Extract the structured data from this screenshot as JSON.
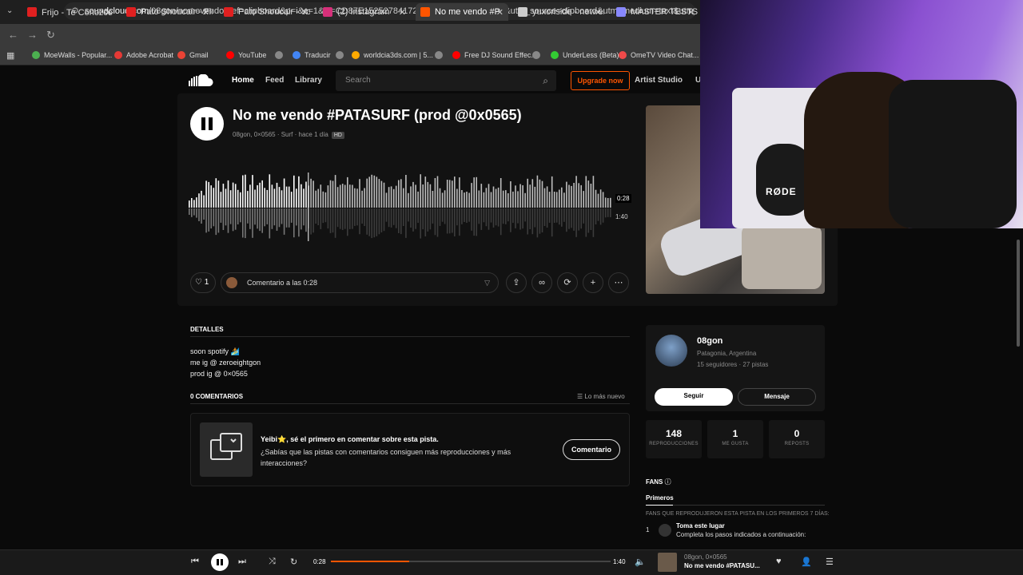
{
  "tabs": [
    {
      "title": "Frijo - Te Conozco 💔",
      "color": "#e02020"
    },
    {
      "title": "Pato Shoucair - Flore",
      "color": "#e02020"
    },
    {
      "title": "Pato Shoucair - YouT",
      "color": "#e02020"
    },
    {
      "title": "(2) Instagram",
      "color": "#d6307a"
    },
    {
      "title": "No me vendo #P",
      "color": "#ff5500",
      "active": true
    },
    {
      "title": "yuxoriside - new era",
      "color": "#cccccc"
    },
    {
      "title": "MASTER TESTS",
      "color": "#8888ff"
    }
  ],
  "address": {
    "host": "soundcloud.com",
    "path": "/08gon/nomevendo?ref=clipboard&p=i&c=1&si=CD87E1525278417291F19E9DC1A8DDF2&utm_source=clipboard&utm_medium=text&utm_campaign=social_sharing"
  },
  "bookmarks": [
    {
      "label": "MoeWalls - Popular...",
      "color": "#4caf50"
    },
    {
      "label": "Adobe Acrobat",
      "color": "#e53935"
    },
    {
      "label": "Gmail",
      "color": "#ea4335"
    },
    {
      "label": "YouTube",
      "color": "#ff0000"
    },
    {
      "label": "",
      "color": "#888888"
    },
    {
      "label": "Traducir",
      "color": "#4285f4"
    },
    {
      "label": "",
      "color": "#888888"
    },
    {
      "label": "worldcia3ds.com | 5...",
      "color": "#ffaa00"
    },
    {
      "label": "",
      "color": "#888888"
    },
    {
      "label": "Free DJ Sound Effec...",
      "color": "#ff0000"
    },
    {
      "label": "",
      "color": "#888888"
    },
    {
      "label": "UnderLess (Beta)",
      "color": "#33cc33"
    },
    {
      "label": "OmeTV Video Chat...",
      "color": "#f04a4a"
    }
  ],
  "header": {
    "home": "Home",
    "feed": "Feed",
    "library": "Library",
    "search_placeholder": "Search",
    "upgrade": "Upgrade now",
    "artist_studio": "Artist Studio",
    "cut": "U"
  },
  "track": {
    "title": "No me vendo #PATASURF (prod @0x0565)",
    "meta": "08gon, 0×0565 · Surf · hace 1 día",
    "hd": "HD",
    "current_time": "0:28",
    "total_time": "1:40",
    "progress": 0.28
  },
  "actions": {
    "like_count": "1",
    "comment_placeholder": "Comentario a las 0:28"
  },
  "details": {
    "heading": "DETALLES",
    "lines": [
      "soon spotify 🏄",
      "me ig @ zeroeightgon",
      "prod ig @ 0×0565"
    ]
  },
  "comments": {
    "heading": "0 COMENTARIOS",
    "sort": "Lo más nuevo",
    "empty_title": "Yeibi⭐, sé el primero en comentar sobre esta pista.",
    "empty_body": "¿Sabías que las pistas con comentarios consiguen más reproducciones y más interacciones?",
    "button": "Comentario"
  },
  "artist": {
    "name": "08gon",
    "location": "Patagonia, Argentina",
    "stats_line": "15 seguidores · 27 pistas",
    "follow": "Seguir",
    "message": "Mensaje"
  },
  "stats": [
    {
      "value": "148",
      "label": "REPRODUCCIONES"
    },
    {
      "value": "1",
      "label": "ME GUSTA"
    },
    {
      "value": "0",
      "label": "REPOSTS"
    }
  ],
  "fans": {
    "heading": "FANS",
    "tab": "Primeros",
    "subtitle": "FANS QUE REPRODUJERON ESTA PISTA EN LOS PRIMEROS 7 DÍAS:",
    "rank": "1",
    "entry_title": "Toma este lugar",
    "entry_body": "Completa los pasos indicados a continuación:"
  },
  "player": {
    "current": "0:28",
    "total": "1:40",
    "artist": "08gon, 0×0565",
    "title": "No me vendo #PATASU..."
  },
  "webcam": {
    "mic_text": "RØDE"
  }
}
